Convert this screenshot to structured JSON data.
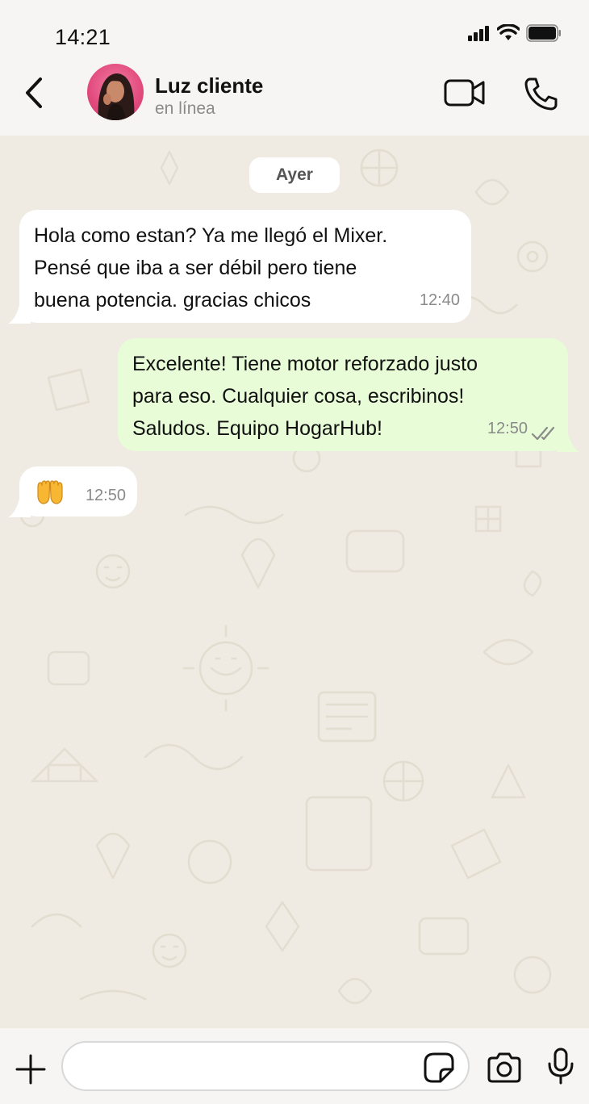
{
  "status_bar": {
    "time": "14:21"
  },
  "header": {
    "back_icon": "chevron-left-icon",
    "contact_name": "Luz cliente",
    "contact_status": "en línea",
    "video_icon": "video-camera-icon",
    "call_icon": "phone-icon"
  },
  "chat": {
    "date_label": "Ayer",
    "messages": [
      {
        "direction": "incoming",
        "text": "Hola como estan? Ya me llegó el Mixer.\nPensé que iba a ser débil pero tiene\nbuena potencia. gracias chicos",
        "time": "12:40"
      },
      {
        "direction": "outgoing",
        "text": "Excelente! Tiene motor reforzado justo\npara eso. Cualquier cosa, escribinos!\nSaludos. Equipo HogarHub!",
        "time": "12:50",
        "status_icon": "double-check-icon"
      },
      {
        "direction": "incoming",
        "text": "🤲",
        "time": "12:50"
      }
    ]
  },
  "input_bar": {
    "value": "",
    "placeholder": ""
  },
  "colors": {
    "outgoing_bubble": "#e7fcd7",
    "incoming_bubble": "#ffffff",
    "chat_background": "#efeae2"
  }
}
